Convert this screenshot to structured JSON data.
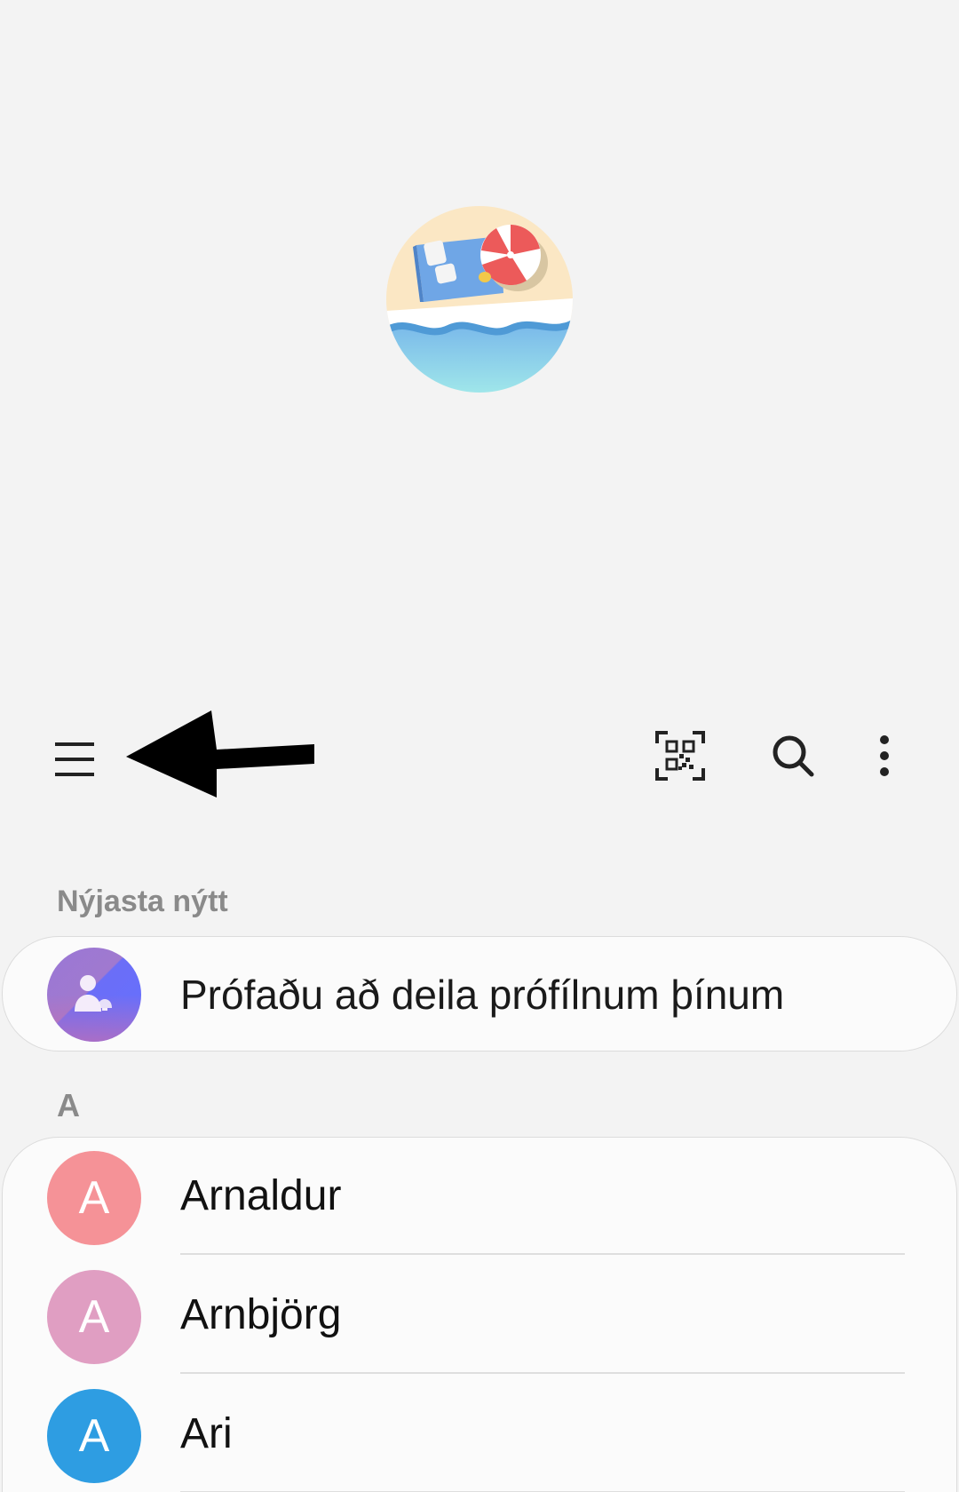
{
  "profile": {
    "avatar_icon": "beach-scene-avatar"
  },
  "toolbar": {
    "menu_icon": "hamburger-menu-icon",
    "annotation": "black-arrow-pointing-left",
    "qr_icon": "qr-code-icon",
    "search_icon": "search-icon",
    "more_icon": "more-vertical-icon"
  },
  "sections": {
    "whats_new_label": "Nýjasta nýtt",
    "promo_text": "Prófaðu að deila prófílnum þínum",
    "letter_a": "A"
  },
  "contacts": [
    {
      "initial": "A",
      "name": "Arnaldur",
      "color": "#f59297"
    },
    {
      "initial": "A",
      "name": "Arnbjörg",
      "color": "#e09ec2"
    },
    {
      "initial": "A",
      "name": "Ari",
      "color": "#2e9de2"
    }
  ],
  "colors": {
    "background": "#f3f3f3",
    "card": "#fbfbfb",
    "section_label": "#8a8a8a"
  }
}
